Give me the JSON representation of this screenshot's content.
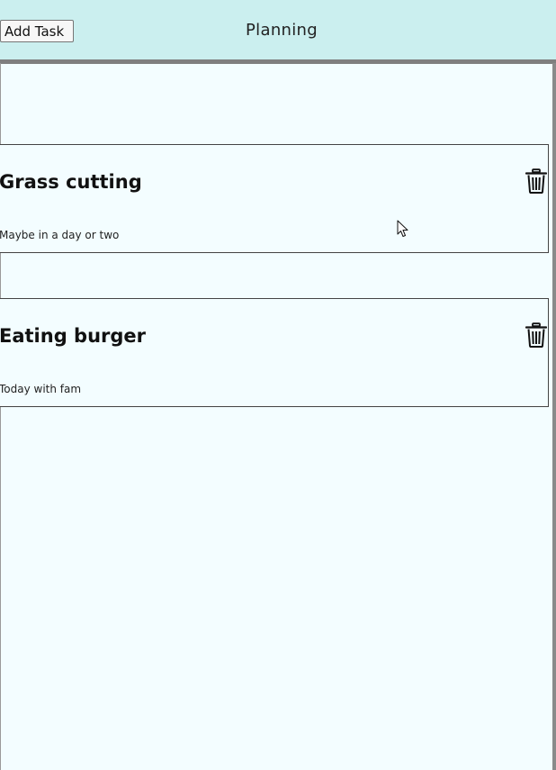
{
  "header": {
    "add_button_label": "Add Task",
    "title": "Planning"
  },
  "tasks": [
    {
      "title": "Grass cutting",
      "description": "Maybe in a day or two",
      "delete_icon": "trash-icon"
    },
    {
      "title": "Eating burger",
      "description": "Today with fam",
      "delete_icon": "trash-icon"
    }
  ],
  "colors": {
    "header_bg": "#cbefef",
    "page_bg": "#f3fdff",
    "divider": "#7f7f7f"
  }
}
